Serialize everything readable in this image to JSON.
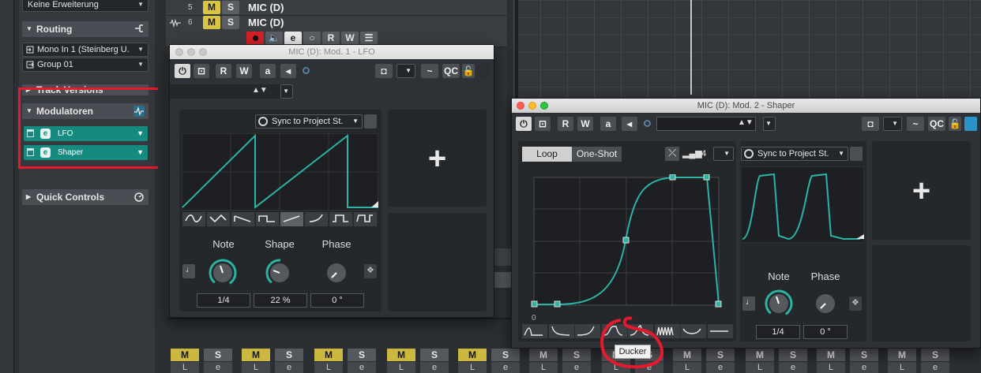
{
  "colors": {
    "accent": "#168a7e",
    "curve": "#2bb3a3",
    "mute": "#d9c544",
    "record": "#e0262d",
    "annotation": "#e8192c"
  },
  "inspector": {
    "top_field": "Keine Erweiterung",
    "routing": {
      "title": "Routing",
      "input": "Mono In 1 (Steinberg U.",
      "output": "Group 01"
    },
    "track_versions": "Track Versions",
    "modulators": {
      "title": "Modulatoren",
      "items": [
        {
          "label": "LFO"
        },
        {
          "label": "Shaper"
        }
      ]
    },
    "quick_controls": "Quick Controls"
  },
  "tracks": [
    {
      "number": "5",
      "mute": "M",
      "solo": "S",
      "name": "MIC (D)"
    },
    {
      "number": "6",
      "mute": "M",
      "solo": "S",
      "name": "MIC (D)"
    }
  ],
  "track_buttons": {
    "read": "R",
    "write": "W"
  },
  "lfo_window": {
    "title": "MIC (D): Mod. 1 - LFO",
    "read": "R",
    "write": "W",
    "auto": "a",
    "qc": "QC",
    "sync": "Sync to Project St.",
    "knobs": [
      {
        "label": "Note",
        "value": "1/4"
      },
      {
        "label": "Shape",
        "value": "22 %"
      },
      {
        "label": "Phase",
        "value": "0 °"
      }
    ],
    "add": "+"
  },
  "shaper_window": {
    "title": "MIC (D): Mod. 2 - Shaper",
    "read": "R",
    "write": "W",
    "auto": "a",
    "qc": "QC",
    "loop": "Loop",
    "one_shot": "One-Shot",
    "steps": "4",
    "sync": "Sync to Project St.",
    "graph_origin": "0",
    "knobs": [
      {
        "label": "Note",
        "value": "1/4"
      },
      {
        "label": "Phase",
        "value": "0 °"
      }
    ],
    "add": "+",
    "tooltip": "Ducker"
  },
  "mixer": {
    "mute": "M",
    "solo": "S",
    "listen": "L",
    "edit": "e"
  }
}
